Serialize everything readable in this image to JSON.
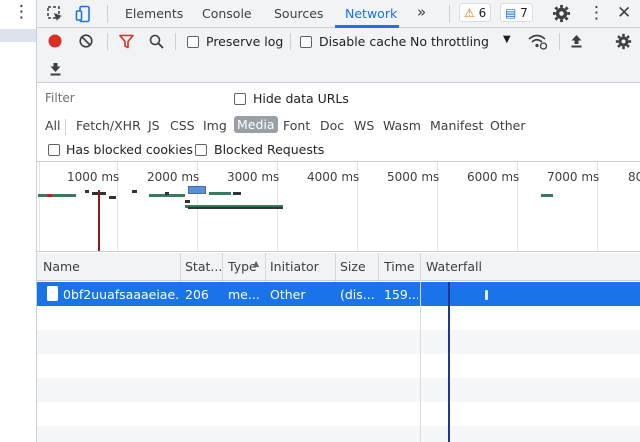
{
  "tabs": {
    "elements": "Elements",
    "console": "Console",
    "sources": "Sources",
    "network": "Network",
    "more": "»"
  },
  "badges": {
    "warnings": "6",
    "issues": "7"
  },
  "toolbar": {
    "preserve_log": "Preserve log",
    "disable_cache": "Disable cache",
    "throttling": "No throttling"
  },
  "filter": {
    "placeholder": "Filter",
    "hide_data_urls": "Hide data URLs"
  },
  "types": [
    "All",
    "Fetch/XHR",
    "JS",
    "CSS",
    "Img",
    "Media",
    "Font",
    "Doc",
    "WS",
    "Wasm",
    "Manifest",
    "Other"
  ],
  "selected_type": "Media",
  "blocked": {
    "cookies": "Has blocked cookies",
    "requests": "Blocked Requests"
  },
  "overview": {
    "ticks": [
      "1000 ms",
      "2000 ms",
      "3000 ms",
      "4000 ms",
      "5000 ms",
      "6000 ms",
      "7000 ms",
      "80"
    ]
  },
  "table": {
    "columns": [
      "Name",
      "Stat...",
      "Type",
      "Initiator",
      "Size",
      "Time",
      "Waterfall"
    ],
    "rows": [
      {
        "name": "0bf2uuafsaaaeiae...",
        "status": "206",
        "type": "me...",
        "initiator": "Other",
        "size": "(dis...",
        "time": "159..."
      }
    ]
  },
  "colors": {
    "accent": "#1a73e8",
    "record": "#d93025",
    "filter_active": "#d93025",
    "selected_row": "#1a73e8"
  }
}
